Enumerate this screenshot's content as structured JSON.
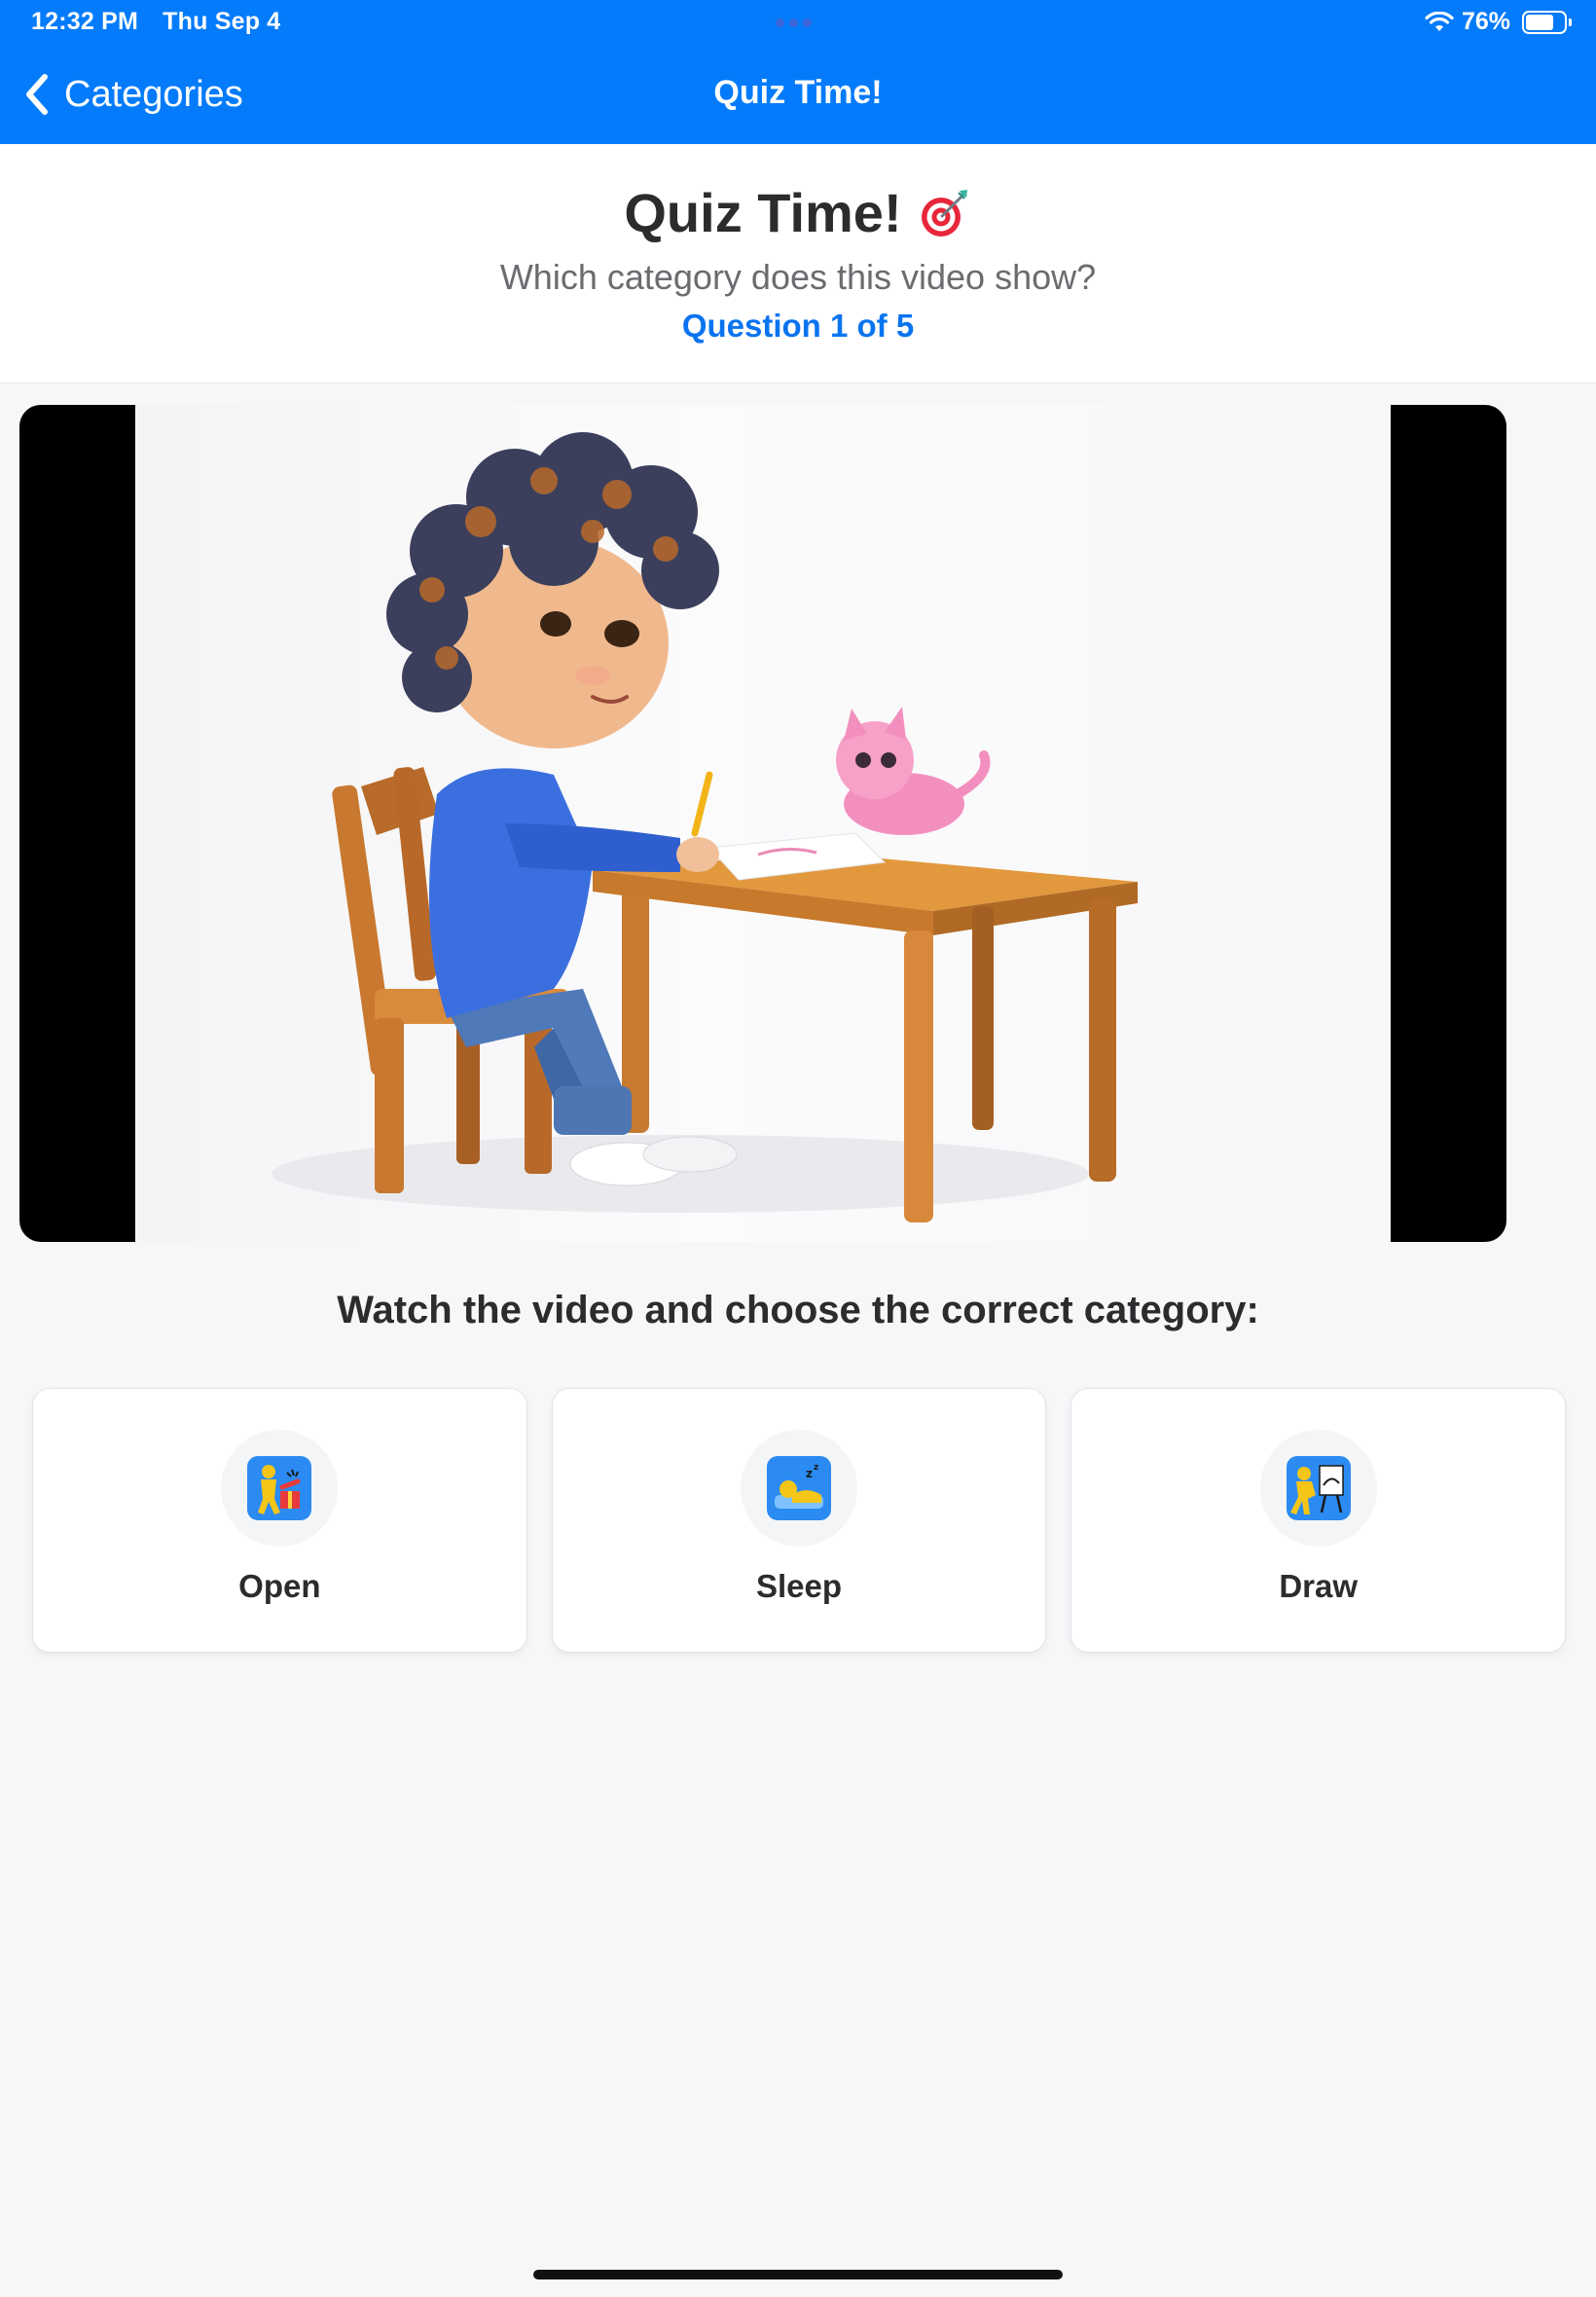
{
  "status_bar": {
    "time": "12:32 PM",
    "date": "Thu Sep 4",
    "battery_text": "76%",
    "battery_level": 0.76
  },
  "nav": {
    "back_label": "Categories",
    "title": "Quiz Time!"
  },
  "header": {
    "title": "Quiz Time!",
    "title_icon": "target-icon",
    "prompt": "Which category does this video show?",
    "progress": "Question 1 of 5"
  },
  "video": {
    "scene": "child-drawing-at-table-with-pink-cat"
  },
  "instruction": "Watch the video and choose the correct category:",
  "options": [
    {
      "label": "Open",
      "icon": "open-gift-icon"
    },
    {
      "label": "Sleep",
      "icon": "sleep-icon"
    },
    {
      "label": "Draw",
      "icon": "draw-easel-icon"
    }
  ],
  "colors": {
    "accent": "#047bfa",
    "link": "#0a74f0",
    "background": "#f6f7f9",
    "card": "#ffffff",
    "icon_tile": "#2b8bf2",
    "figure": "#f5c518"
  }
}
